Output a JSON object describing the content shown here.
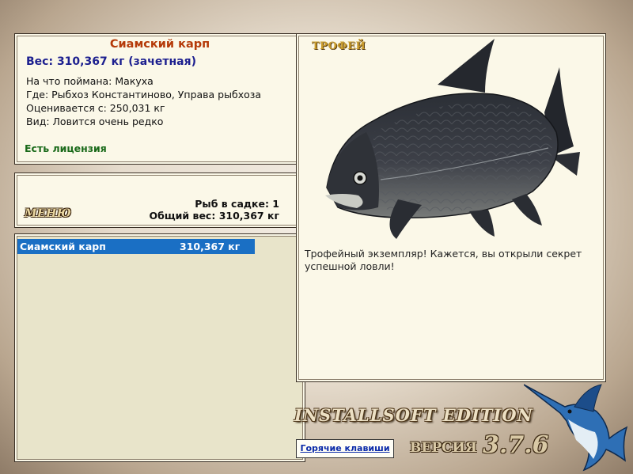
{
  "info": {
    "fish_name": "Сиамский карп",
    "weight_line": "Вес: 310,367 кг (зачетная)",
    "caught_on": "На что поймана: Макуха",
    "location": "Где: Рыбхоз Константиново, Управа рыбхоза",
    "valued_from": "Оценивается с: 250,031 кг",
    "kind": "Вид: Ловится очень редко",
    "license": "Есть лицензия"
  },
  "menu": {
    "label": "МЕНЮ",
    "fish_count": "Рыб в садке: 1",
    "total_weight": "Общий вес: 310,367 кг"
  },
  "catch_list": [
    {
      "name": "Сиамский карп",
      "weight": "310,367 кг"
    }
  ],
  "trophy": {
    "label": "ТРОФЕЙ",
    "text": "Трофейный экземпляр! Кажется, вы открыли секрет успешной ловли!",
    "icon": "siamese-carp-image"
  },
  "footer": {
    "edition": "INSTALLSOFT EDITION",
    "hotkeys": "Горячие клавиши",
    "version_label": "ВЕРСИЯ",
    "version": "3.7.6",
    "logo_icon": "marlin-icon"
  },
  "colors": {
    "fish_name": "#b53a09",
    "weight": "#1c1f8f",
    "license": "#1a6a1a",
    "selection": "#1a6fc4"
  }
}
